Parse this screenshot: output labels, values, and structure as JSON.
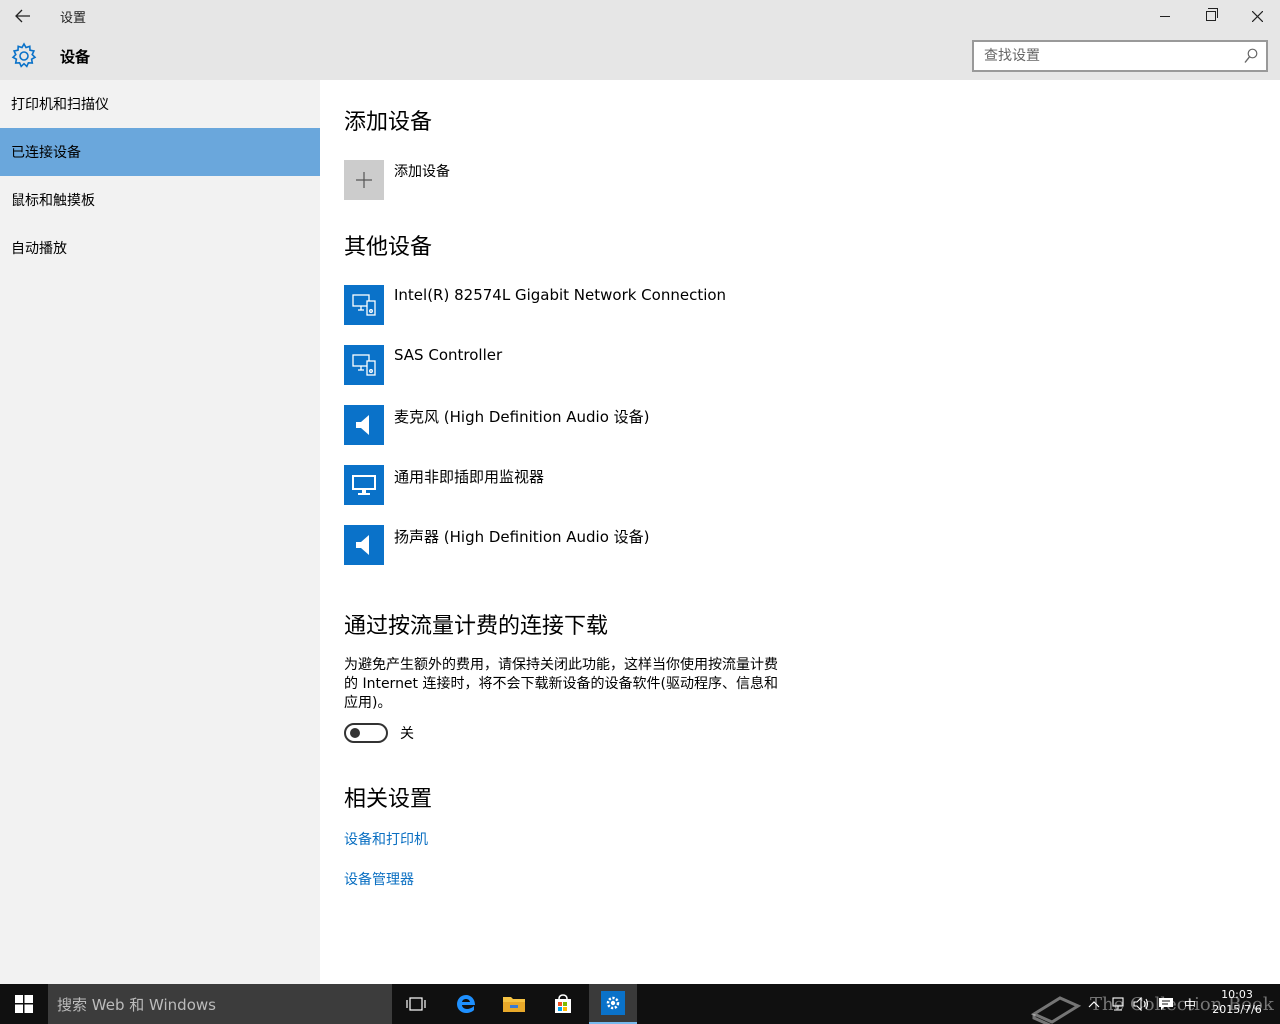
{
  "window": {
    "back_icon": "back-arrow-icon",
    "title": "设置",
    "controls": [
      "minimize-icon",
      "restore-icon",
      "close-icon"
    ]
  },
  "header": {
    "icon": "gear-icon",
    "title": "设备",
    "search_placeholder": "查找设置",
    "search_icon": "search-icon"
  },
  "sidebar": {
    "items": [
      {
        "label": "打印机和扫描仪",
        "active": false
      },
      {
        "label": "已连接设备",
        "active": true
      },
      {
        "label": "鼠标和触摸板",
        "active": false
      },
      {
        "label": "自动播放",
        "active": false
      }
    ],
    "active_color": "#6aa7dc"
  },
  "main": {
    "add_section": {
      "heading": "添加设备",
      "add_label": "添加设备",
      "add_icon": "plus-icon"
    },
    "other_section": {
      "heading": "其他设备",
      "devices": [
        {
          "label": "Intel(R) 82574L Gigabit Network Connection",
          "icon": "device-icon"
        },
        {
          "label": "SAS Controller",
          "icon": "device-icon"
        },
        {
          "label": "麦克风 (High Definition Audio 设备)",
          "icon": "speaker-icon"
        },
        {
          "label": "通用非即插即用监视器",
          "icon": "monitor-icon"
        },
        {
          "label": "扬声器 (High Definition Audio 设备)",
          "icon": "speaker-icon"
        }
      ],
      "tile_color": "#0a72c9"
    },
    "metered_section": {
      "heading": "通过按流量计费的连接下载",
      "description": "为避免产生额外的费用，请保持关闭此功能，这样当你使用按流量计费的 Internet 连接时，将不会下载新设备的设备软件(驱动程序、信息和应用)。",
      "toggle_state": "off",
      "toggle_label": "关"
    },
    "related_section": {
      "heading": "相关设置",
      "links": [
        "设备和打印机",
        "设备管理器"
      ],
      "link_color": "#0a6fc2"
    }
  },
  "taskbar": {
    "start_icon": "windows-start-icon",
    "search_placeholder": "搜索 Web 和 Windows",
    "apps": [
      "task-view-icon",
      "edge-icon",
      "file-explorer-icon",
      "store-icon",
      "settings-icon"
    ],
    "active_app": "settings-icon",
    "watermark": "The Collection Book",
    "tray": {
      "icons": [
        "chevron-up-icon",
        "network-icon",
        "volume-icon",
        "action-center-icon"
      ],
      "ime": "中",
      "time": "10:03",
      "date": "2015/7/6"
    }
  }
}
